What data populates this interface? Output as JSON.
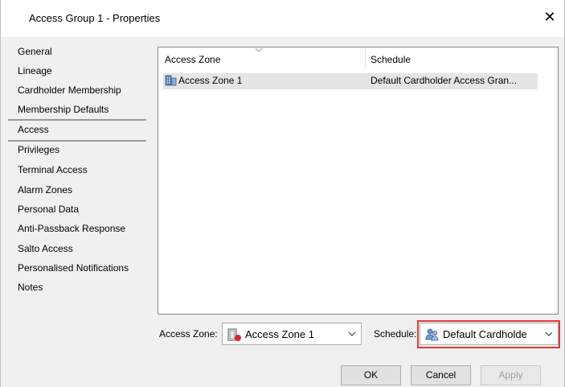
{
  "window": {
    "title": "Access Group 1 - Properties",
    "close_glyph": "✕"
  },
  "nav": {
    "items": [
      {
        "label": "General"
      },
      {
        "label": "Lineage"
      },
      {
        "label": "Cardholder Membership"
      },
      {
        "label": "Membership Defaults"
      },
      {
        "label": "Access"
      },
      {
        "label": "Privileges"
      },
      {
        "label": "Terminal Access"
      },
      {
        "label": "Alarm Zones"
      },
      {
        "label": "Personal Data"
      },
      {
        "label": "Anti-Passback Response"
      },
      {
        "label": "Salto Access"
      },
      {
        "label": "Personalised Notifications"
      },
      {
        "label": "Notes"
      }
    ],
    "selected": "Access"
  },
  "grid": {
    "columns": [
      "Access Zone",
      "Schedule"
    ],
    "rows": [
      {
        "zone": "Access Zone 1",
        "schedule": "Default Cardholder Access Gran...",
        "icon": "access-zone-icon"
      }
    ]
  },
  "editor": {
    "zone_label": "Access Zone:",
    "zone_value": "Access Zone 1",
    "schedule_label": "Schedule:",
    "schedule_value": "Default Cardholde"
  },
  "buttons": {
    "ok": "OK",
    "cancel": "Cancel",
    "apply": "Apply"
  },
  "colors": {
    "highlight": "#e03a3a",
    "selection_row": "#e5e5e5"
  }
}
